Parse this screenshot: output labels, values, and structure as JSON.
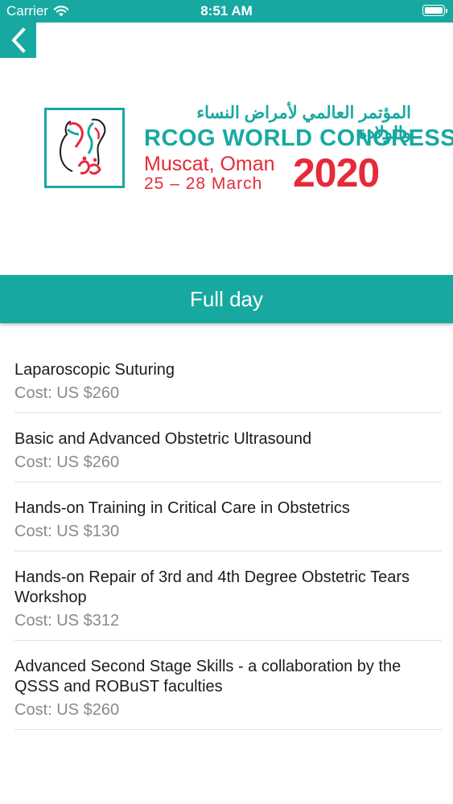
{
  "status_bar": {
    "carrier": "Carrier",
    "time": "8:51 AM",
    "wifi_icon": "wifi-icon",
    "battery_icon": "battery-icon"
  },
  "navigation": {
    "back_icon": "chevron-left-icon"
  },
  "logo": {
    "arabic_title": "المؤتمر العالمي لأمراض النساء والولادة",
    "congress_name": "RCOG WORLD CONGRESS",
    "city": "Muscat, Oman",
    "dates": "25 – 28 March",
    "year": "2020",
    "emblem_icon": "oman-figures-emblem-icon",
    "colors": {
      "teal": "#17a9a1",
      "red": "#e62a3a"
    }
  },
  "section": {
    "title": "Full day"
  },
  "courses": [
    {
      "title": "Laparoscopic Suturing",
      "cost": "Cost: US $260"
    },
    {
      "title": "Basic and Advanced Obstetric Ultrasound",
      "cost": "Cost: US $260"
    },
    {
      "title": "Hands-on Training in Critical Care in Obstetrics",
      "cost": "Cost: US $130"
    },
    {
      "title": "Hands-on Repair of 3rd and 4th Degree Obstetric Tears Workshop",
      "cost": "Cost: US $312"
    },
    {
      "title": "Advanced Second Stage Skills - a collaboration by the QSSS and ROBuST faculties",
      "cost": "Cost: US $260"
    }
  ],
  "theme": {
    "accent": "#17a9a1"
  }
}
